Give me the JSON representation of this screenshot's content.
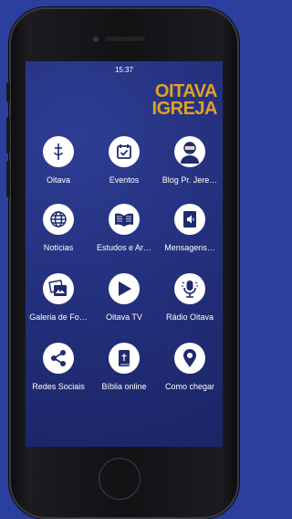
{
  "status": {
    "time": "15:37"
  },
  "logo": {
    "line1": "OITAVA",
    "line2": "IGREJA"
  },
  "items": [
    {
      "label": "Oitava",
      "icon": "cross-icon"
    },
    {
      "label": "Eventos",
      "icon": "calendar-check-icon"
    },
    {
      "label": "Blog Pr. Jere…",
      "icon": "pastor-avatar-icon"
    },
    {
      "label": "Notícias",
      "icon": "globe-icon"
    },
    {
      "label": "Estudos e Ar…",
      "icon": "open-book-icon"
    },
    {
      "label": "Mensagens…",
      "icon": "audio-book-icon"
    },
    {
      "label": "Galeria de Fo…",
      "icon": "photo-gallery-icon"
    },
    {
      "label": "Oitava TV",
      "icon": "play-icon"
    },
    {
      "label": "Rádio Oitava",
      "icon": "microphone-icon"
    },
    {
      "label": "Redes Sociais",
      "icon": "share-icon"
    },
    {
      "label": "Bíblia online",
      "icon": "bible-icon"
    },
    {
      "label": "Como chegar",
      "icon": "map-pin-icon"
    }
  ],
  "colors": {
    "background": "#2a3f9e",
    "screen": "#222e78",
    "logo": "#e0a126",
    "icon_fill": "#1f2a70"
  }
}
